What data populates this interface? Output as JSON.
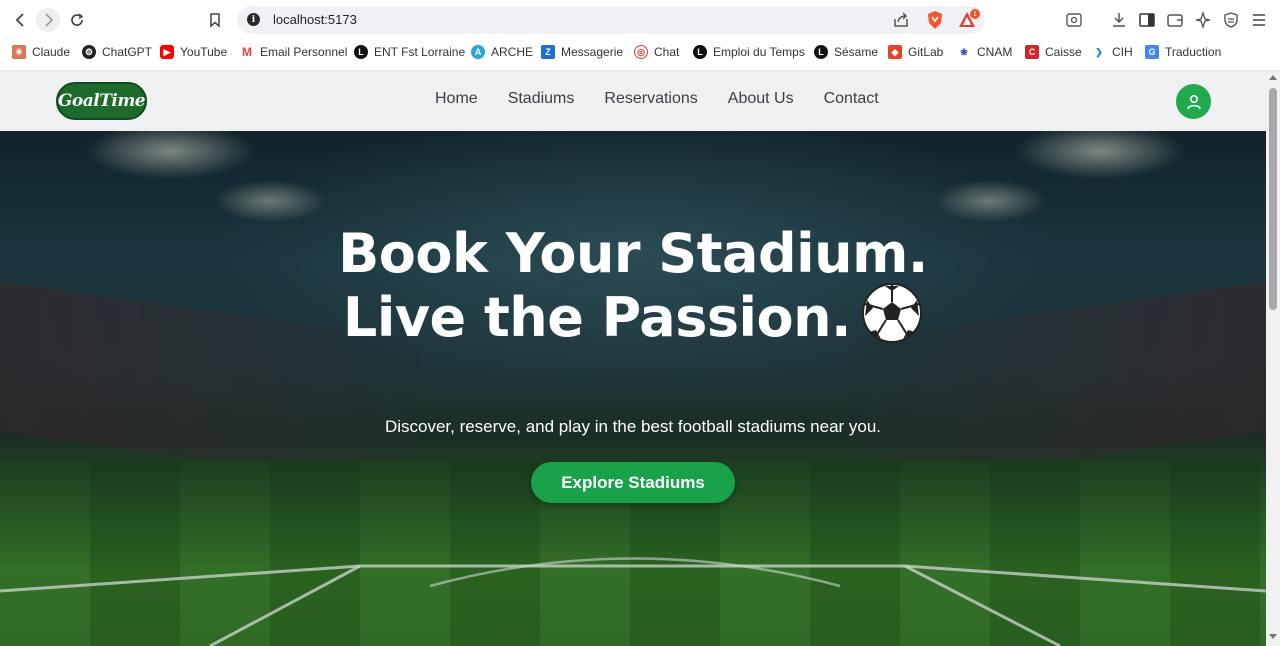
{
  "browser": {
    "url": "localhost:5173",
    "rewards_badge": "1",
    "bookmarks": [
      {
        "label": "Claude",
        "icon": "claude-icon",
        "color": "#d97757"
      },
      {
        "label": "ChatGPT",
        "icon": "chatgpt-icon",
        "color": "#222222"
      },
      {
        "label": "YouTube",
        "icon": "youtube-icon",
        "color": "#ff0000"
      },
      {
        "label": "Email Personnel",
        "icon": "gmail-icon",
        "color": "#ea4335"
      },
      {
        "label": "ENT Fst Lorraine",
        "icon": "universite-lorraine-icon",
        "color": "#111111"
      },
      {
        "label": "ARCHE",
        "icon": "arche-icon",
        "color": "#2aa7d6"
      },
      {
        "label": "Messagerie",
        "icon": "zimbra-icon",
        "color": "#1f6fd1"
      },
      {
        "label": "Chat",
        "icon": "chat-icon",
        "color": "#e03a2f"
      },
      {
        "label": "Emploi du Temps",
        "icon": "universite-lorraine-icon",
        "color": "#111111"
      },
      {
        "label": "Sésame",
        "icon": "universite-lorraine-icon",
        "color": "#111111"
      },
      {
        "label": "GitLab",
        "icon": "gitlab-icon",
        "color": "#e24329"
      },
      {
        "label": "CNAM",
        "icon": "cnam-icon",
        "color": "#2c4b9a"
      },
      {
        "label": "Caisse",
        "icon": "caisse-icon",
        "color": "#d6242b"
      },
      {
        "label": "CIH",
        "icon": "cih-icon",
        "color": "#1e88d8"
      },
      {
        "label": "Traduction",
        "icon": "google-translate-icon",
        "color": "#4285f4"
      }
    ]
  },
  "site": {
    "logo_text": "GoalTime",
    "nav": [
      "Home",
      "Stadiums",
      "Reservations",
      "About Us",
      "Contact"
    ],
    "brand_color": "#1aa24a"
  },
  "hero": {
    "title": "Book Your Stadium. Live the Passion.",
    "subtitle": "Discover, reserve, and play in the best football stadiums near you.",
    "cta": "Explore Stadiums"
  }
}
